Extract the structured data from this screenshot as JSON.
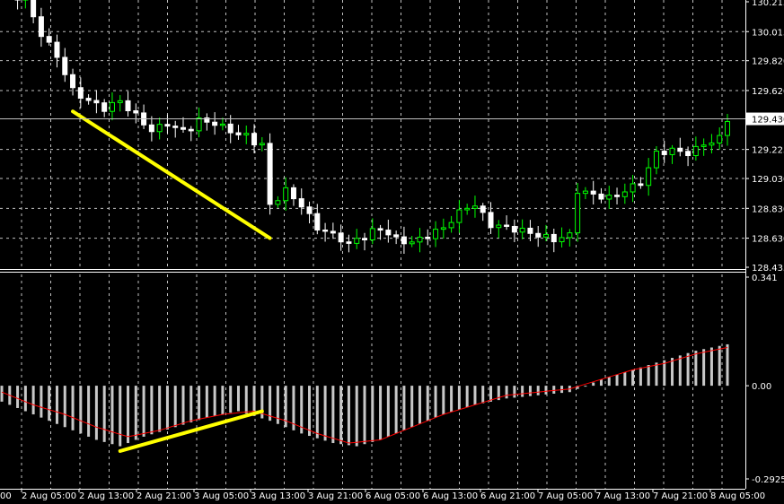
{
  "chart_data": [
    {
      "type": "candlestick",
      "title": "",
      "price_levels": [
        "130.215",
        "130.015",
        "129.820",
        "129.620",
        "129.430",
        "129.225",
        "129.030",
        "128.830",
        "128.630",
        "128.435"
      ],
      "current_price": "129.430",
      "ylim": [
        128.435,
        130.215
      ],
      "grid": true,
      "colors": {
        "bull": "#00ff00",
        "bear": "#ffffff",
        "background": "#000000",
        "grid": "#c0c0c0"
      },
      "x_labels": [
        "00",
        "2 Aug 05:00",
        "2 Aug 13:00",
        "2 Aug 21:00",
        "3 Aug 05:00",
        "3 Aug 13:00",
        "3 Aug 21:00",
        "6 Aug 05:00",
        "6 Aug 13:00",
        "6 Aug 21:00",
        "7 Aug 05:00",
        "7 Aug 13:00",
        "7 Aug 21:00",
        "8 Aug 05:00"
      ],
      "close_path": [
        [
          0,
          130.3
        ],
        [
          3,
          130.22
        ],
        [
          5,
          130.0
        ],
        [
          7,
          129.85
        ],
        [
          9,
          129.62
        ],
        [
          11,
          129.55
        ],
        [
          13,
          129.5
        ],
        [
          15,
          129.55
        ],
        [
          17,
          129.45
        ],
        [
          19,
          129.35
        ],
        [
          21,
          129.4
        ],
        [
          23,
          129.35
        ],
        [
          25,
          129.42
        ],
        [
          27,
          129.4
        ],
        [
          29,
          129.35
        ],
        [
          31,
          129.3
        ],
        [
          33,
          129.25
        ],
        [
          34,
          128.85
        ],
        [
          36,
          128.95
        ],
        [
          38,
          128.85
        ],
        [
          40,
          128.7
        ],
        [
          42,
          128.65
        ],
        [
          44,
          128.6
        ],
        [
          46,
          128.65
        ],
        [
          48,
          128.7
        ],
        [
          50,
          128.62
        ],
        [
          52,
          128.6
        ],
        [
          54,
          128.65
        ],
        [
          56,
          128.7
        ],
        [
          58,
          128.8
        ],
        [
          60,
          128.85
        ],
        [
          62,
          128.72
        ],
        [
          64,
          128.7
        ],
        [
          66,
          128.68
        ],
        [
          68,
          128.65
        ],
        [
          70,
          128.62
        ],
        [
          72,
          128.65
        ],
        [
          73,
          128.95
        ],
        [
          75,
          128.92
        ],
        [
          77,
          128.9
        ],
        [
          79,
          128.95
        ],
        [
          81,
          129.0
        ],
        [
          83,
          129.2
        ],
        [
          85,
          129.22
        ],
        [
          87,
          129.2
        ],
        [
          89,
          129.25
        ],
        [
          91,
          129.3
        ],
        [
          92,
          129.43
        ]
      ],
      "trendline_color": "#ffff00",
      "trendline": {
        "from": [
          9,
          129.48
        ],
        "to": [
          34,
          128.63
        ]
      }
    },
    {
      "type": "bar",
      "name": "",
      "levels": [
        "0.341",
        "0.00",
        "-0.2925"
      ],
      "ylim": [
        -0.2925,
        0.341
      ],
      "colors": {
        "bars": "#c8c8c8",
        "signal": "#ff0000"
      },
      "histogram_path": [
        [
          0,
          -0.05
        ],
        [
          4,
          -0.09
        ],
        [
          8,
          -0.13
        ],
        [
          12,
          -0.17
        ],
        [
          15,
          -0.19
        ],
        [
          18,
          -0.16
        ],
        [
          22,
          -0.13
        ],
        [
          26,
          -0.1
        ],
        [
          30,
          -0.08
        ],
        [
          34,
          -0.11
        ],
        [
          38,
          -0.15
        ],
        [
          42,
          -0.18
        ],
        [
          45,
          -0.19
        ],
        [
          48,
          -0.17
        ],
        [
          52,
          -0.13
        ],
        [
          56,
          -0.09
        ],
        [
          60,
          -0.06
        ],
        [
          64,
          -0.04
        ],
        [
          68,
          -0.03
        ],
        [
          72,
          -0.02
        ],
        [
          76,
          0.02
        ],
        [
          80,
          0.05
        ],
        [
          84,
          0.08
        ],
        [
          88,
          0.11
        ],
        [
          92,
          0.13
        ]
      ],
      "signal_path": [
        [
          0,
          -0.02
        ],
        [
          4,
          -0.06
        ],
        [
          8,
          -0.09
        ],
        [
          12,
          -0.13
        ],
        [
          16,
          -0.16
        ],
        [
          20,
          -0.14
        ],
        [
          24,
          -0.11
        ],
        [
          28,
          -0.09
        ],
        [
          32,
          -0.08
        ],
        [
          36,
          -0.11
        ],
        [
          40,
          -0.15
        ],
        [
          44,
          -0.18
        ],
        [
          48,
          -0.17
        ],
        [
          52,
          -0.13
        ],
        [
          56,
          -0.09
        ],
        [
          60,
          -0.06
        ],
        [
          64,
          -0.03
        ],
        [
          68,
          -0.02
        ],
        [
          72,
          -0.01
        ],
        [
          76,
          0.02
        ],
        [
          80,
          0.05
        ],
        [
          84,
          0.07
        ],
        [
          88,
          0.1
        ],
        [
          92,
          0.12
        ]
      ],
      "trendline_color": "#ffff00",
      "trendline": {
        "from": [
          15,
          -0.205
        ],
        "to": [
          33,
          -0.08
        ]
      }
    }
  ]
}
